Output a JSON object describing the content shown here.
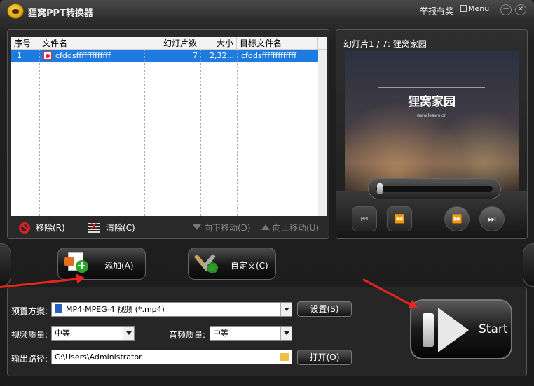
{
  "window": {
    "title": "狸窝PPT转换器",
    "report_label": "举报有奖",
    "menu_label": "Menu",
    "minimize_glyph": "－",
    "close_glyph": "✕"
  },
  "file_table": {
    "columns": [
      "序号",
      "文件名",
      "幻灯片数",
      "大小",
      "目标文件名"
    ],
    "rows": [
      {
        "index": "1",
        "file_name": "cfddsfffffffffffff",
        "slides": "7",
        "size": "2,32...",
        "target_name": "cfddsfffffffffffff"
      }
    ]
  },
  "list_actions": {
    "remove": "移除(R)",
    "clear": "清除(C)",
    "move_down": "向下移动(D)",
    "move_up": "向上移动(U)"
  },
  "preview": {
    "slide_label": "幻灯片1 / 7: 狸窝家园",
    "slide_title": "狸窝家园",
    "slide_subtitle": "www.leawo.cn"
  },
  "buttons": {
    "add": "添加(A)",
    "customize": "自定义(C)",
    "settings": "设置(S)",
    "open": "打开(O)",
    "start": "Start"
  },
  "settings": {
    "preset_label": "预置方案:",
    "preset_value": "MP4-MPEG-4 视频 (*.mp4)",
    "video_quality_label": "视频质量:",
    "video_quality_value": "中等",
    "audio_quality_label": "音频质量:",
    "audio_quality_value": "中等",
    "output_path_label": "输出路径:",
    "output_path_value": "C:\\Users\\Administrator"
  },
  "colors": {
    "selection": "#1e7be0",
    "annotation_arrow": "#e8251d",
    "remove_icon": "#e02020"
  }
}
